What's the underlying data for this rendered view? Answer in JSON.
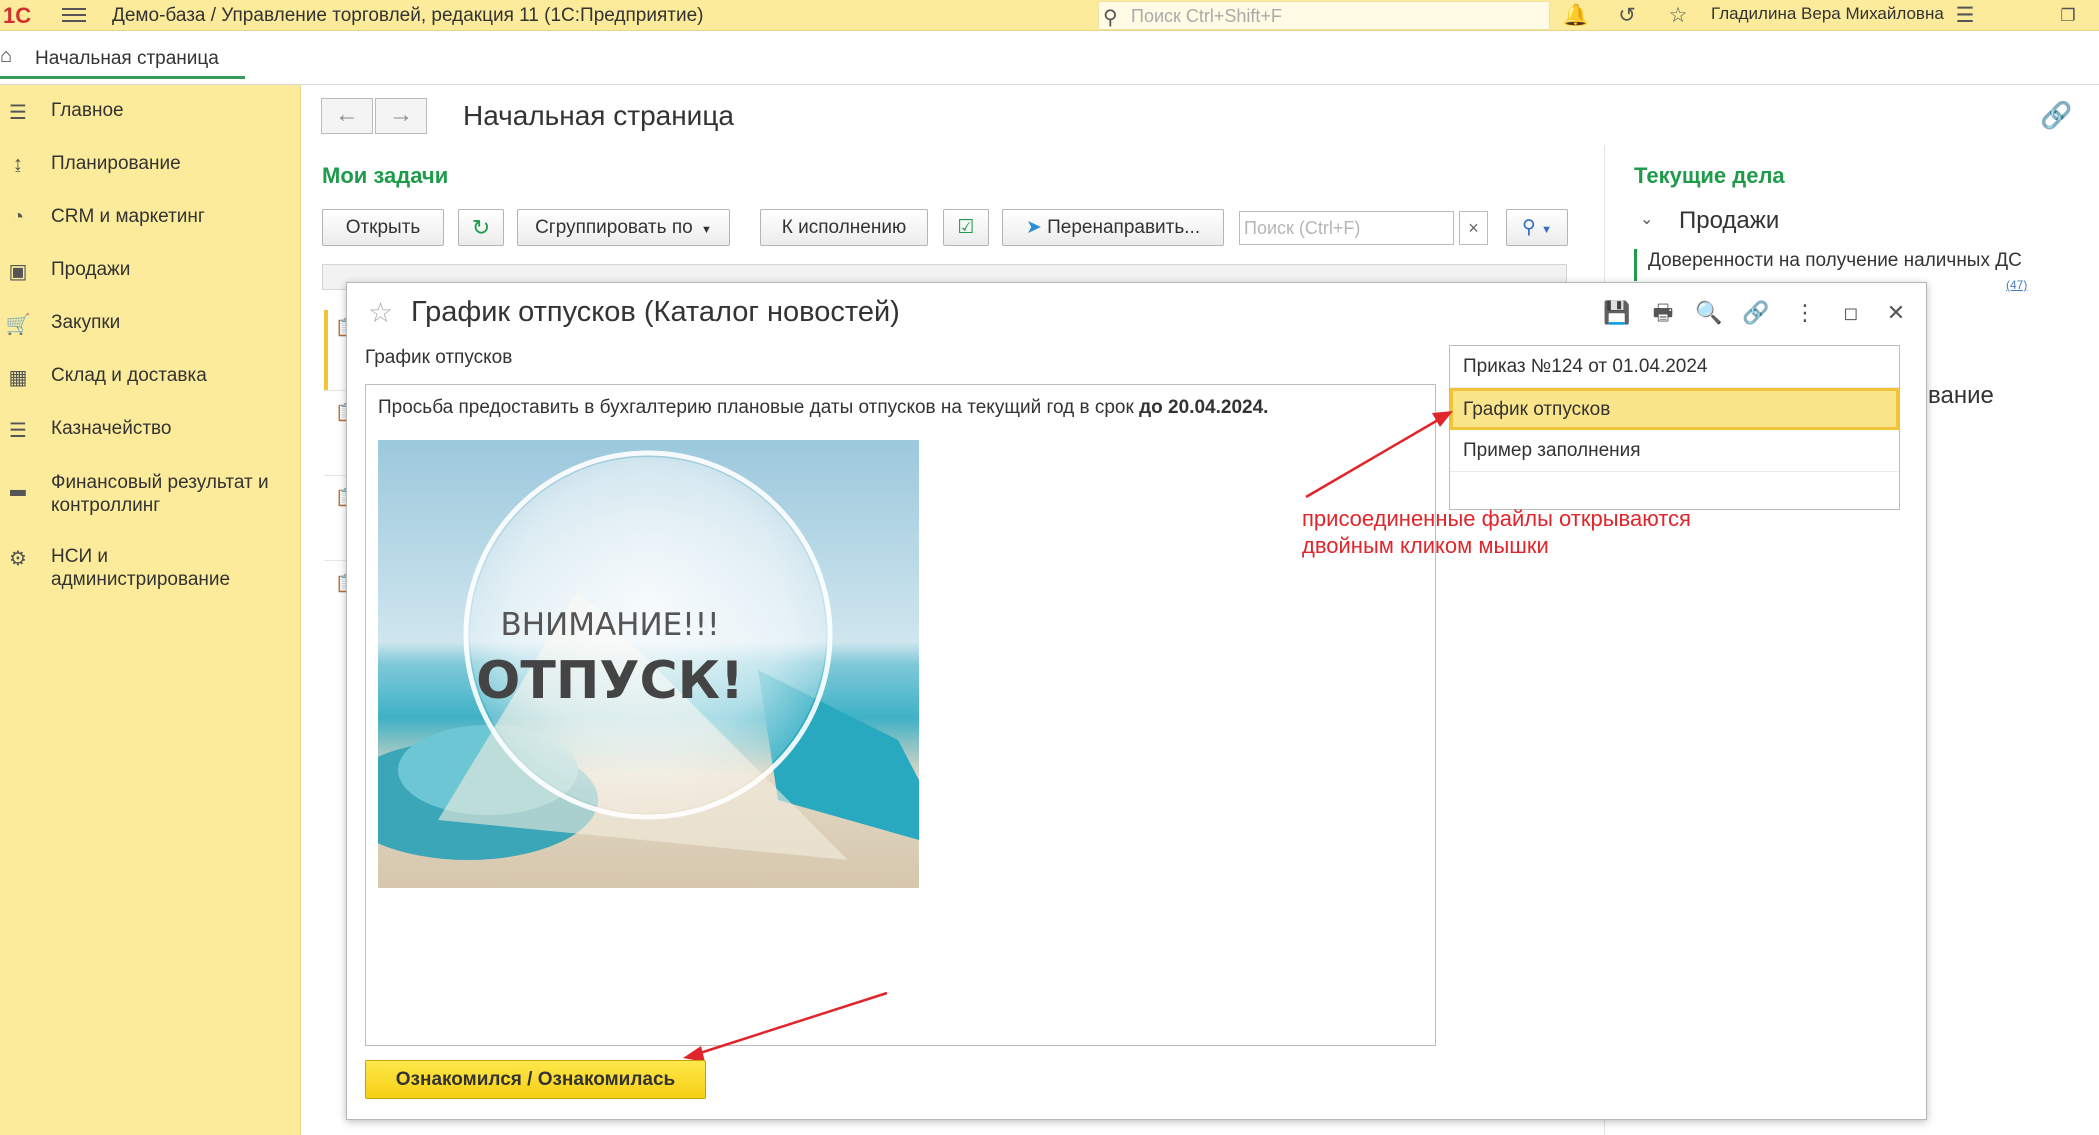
{
  "topbar": {
    "logo": "1С",
    "app_title": "Демо-база / Управление торговлей, редакция 11  (1С:Предприятие)",
    "search_placeholder": "Поиск Ctrl+Shift+F",
    "user_name": "Гладилина Вера Михайловна",
    "icons": [
      "bell-icon",
      "history-icon",
      "star-icon",
      "settings-menu-icon",
      "restore-window-icon"
    ]
  },
  "tabs": [
    {
      "label": "Начальная страница",
      "icon": "home-icon",
      "active": true
    }
  ],
  "sidebar": {
    "items": [
      {
        "label": "Главное",
        "icon": "list-icon"
      },
      {
        "label": "Планирование",
        "icon": "planning-icon"
      },
      {
        "label": "CRM и маркетинг",
        "icon": "pie-chart-icon"
      },
      {
        "label": "Продажи",
        "icon": "bag-icon"
      },
      {
        "label": "Закупки",
        "icon": "cart-icon"
      },
      {
        "label": "Склад и доставка",
        "icon": "warehouse-icon"
      },
      {
        "label": "Казначейство",
        "icon": "coins-icon"
      },
      {
        "label": "Финансовый результат и контроллинг",
        "icon": "bar-chart-icon"
      },
      {
        "label": "НСИ и администрирование",
        "icon": "gear-icon"
      }
    ]
  },
  "page": {
    "title": "Начальная страница"
  },
  "tasks": {
    "title": "Мои задачи",
    "buttons": {
      "open": "Открыть",
      "group_by": "Сгруппировать по",
      "to_execution": "К исполнению",
      "redirect": "Перенаправить..."
    },
    "search_placeholder": "Поиск (Ctrl+F)",
    "search_clear": "×"
  },
  "current_affairs": {
    "title": "Текущие дела",
    "group": "Продажи",
    "item": "Доверенности на получение наличных ДС",
    "item_count": "(47)",
    "partial_text": "вание"
  },
  "modal": {
    "title": "График отпусков (Каталог новостей)",
    "doc_label": "График отпусков",
    "text_prefix": "Просьба предоставить в бухгалтерию плановые даты отпусков на текущий год в срок ",
    "text_bold": "до 20.04.2024.",
    "image_line1": "ВНИМАНИЕ!!!",
    "image_line2": "ОТПУСК!",
    "attachments": [
      {
        "label": "Приказ №124 от 01.04.2024",
        "selected": false
      },
      {
        "label": "График отпусков",
        "selected": true
      },
      {
        "label": "Пример заполнения",
        "selected": false
      }
    ],
    "ack_button": "Ознакомился / Ознакомилась",
    "icons": [
      "save-icon",
      "print-icon",
      "preview-icon",
      "link-icon",
      "more-icon",
      "maximize-icon",
      "close-icon"
    ]
  },
  "annotation": {
    "note_line1": "присоединенные файлы открываются",
    "note_line2": "двойным кликом мышки"
  },
  "colors": {
    "panel_yellow": "#fbeb9b",
    "accent_green": "#1f9b4b",
    "button_yellow": "#f6cf14",
    "selected_row": "#fbe58a",
    "annotation_red": "#e0252b"
  }
}
